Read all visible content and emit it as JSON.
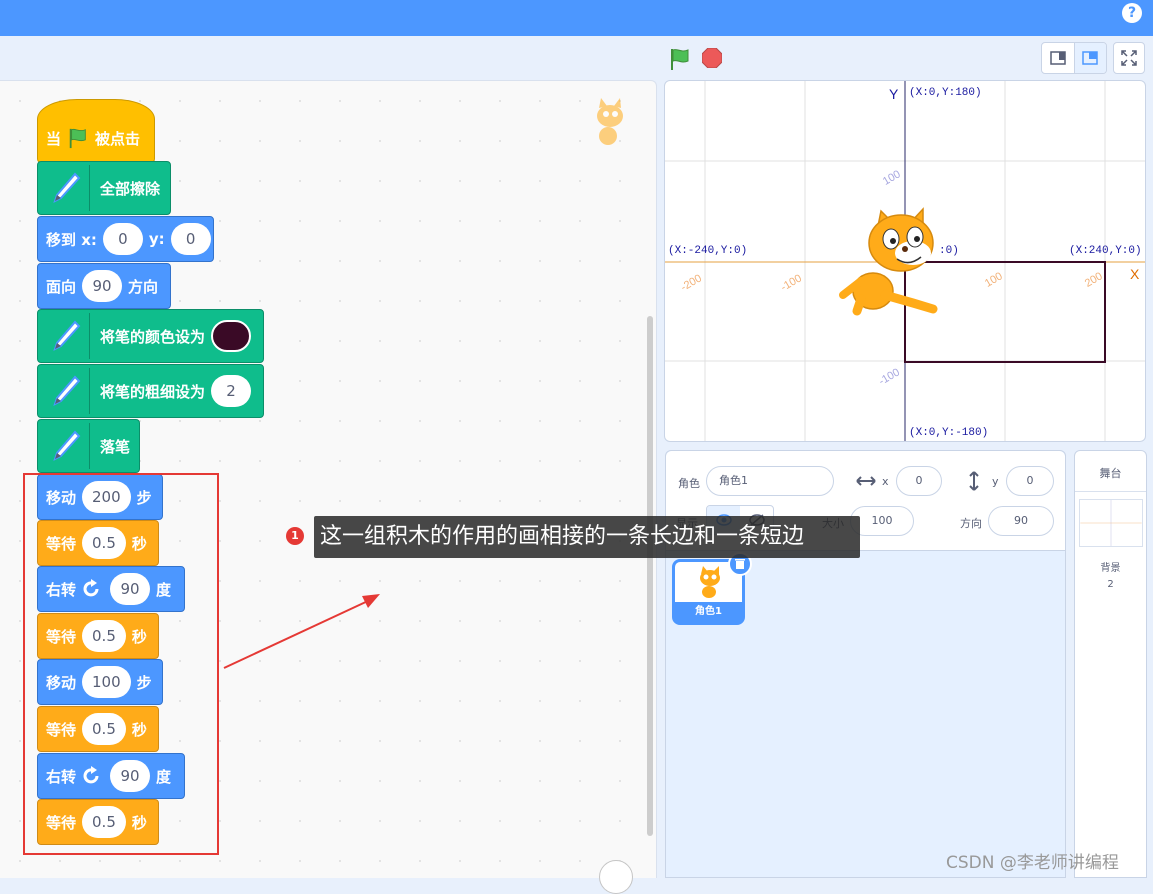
{
  "help": {
    "label": "?"
  },
  "blocks": {
    "when_flag": {
      "prefix": "当",
      "suffix": "被点击"
    },
    "clear": {
      "label": "全部擦除"
    },
    "goto": {
      "label": "移到 x:",
      "x": "0",
      "y_label": "y:",
      "y": "0"
    },
    "point": {
      "label": "面向",
      "value": "90",
      "suffix": "方向"
    },
    "set_color": {
      "label": "将笔的颜色设为",
      "color": "#3a0a26"
    },
    "set_size": {
      "label": "将笔的粗细设为",
      "value": "2"
    },
    "pen_down": {
      "label": "落笔"
    },
    "move1": {
      "label": "移动",
      "value": "200",
      "suffix": "步"
    },
    "wait1": {
      "label": "等待",
      "value": "0.5",
      "suffix": "秒"
    },
    "turn1": {
      "label": "右转",
      "value": "90",
      "suffix": "度"
    },
    "wait2": {
      "label": "等待",
      "value": "0.5",
      "suffix": "秒"
    },
    "move2": {
      "label": "移动",
      "value": "100",
      "suffix": "步"
    },
    "wait3": {
      "label": "等待",
      "value": "0.5",
      "suffix": "秒"
    },
    "turn2": {
      "label": "右转",
      "value": "90",
      "suffix": "度"
    },
    "wait4": {
      "label": "等待",
      "value": "0.5",
      "suffix": "秒"
    }
  },
  "stage": {
    "axis_y": "Y",
    "axis_x": "X",
    "top_label": "(X:0,Y:180)",
    "bottom_label": "(X:0,Y:-180)",
    "left_label": "(X:-240,Y:0)",
    "right_label": "(X:240,Y:0)",
    "center_label": ":0)",
    "tick_x": [
      "-200",
      "-100",
      "100",
      "200"
    ],
    "tick_y": [
      "100",
      "-100"
    ]
  },
  "sprite_info": {
    "sprite_label": "角色",
    "sprite_name": "角色1",
    "x_label": "x",
    "x_value": "0",
    "y_label": "y",
    "y_value": "0",
    "show_label": "显示",
    "size_label": "大小",
    "size_value": "100",
    "direction_label": "方向",
    "direction_value": "90"
  },
  "sprite_tile": {
    "name": "角色1"
  },
  "stage_panel": {
    "title": "舞台",
    "backdrops_label": "背景",
    "backdrops_count": "2"
  },
  "annotation": {
    "number": "1",
    "text": "这一组积木的作用的画相接的一条长边和一条短边"
  },
  "watermark": "CSDN @李老师讲编程",
  "colors": {
    "motion": "#4c97ff",
    "control": "#ffab19",
    "pen": "#0fbd8c",
    "event": "#ffbf00",
    "highlight": "#e53935"
  }
}
